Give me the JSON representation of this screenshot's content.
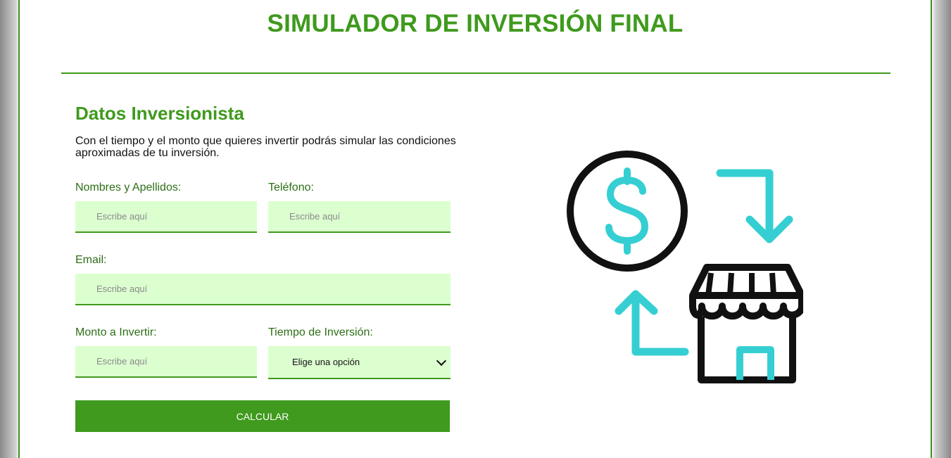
{
  "header": {
    "title": "SIMULADOR DE INVERSIÓN FINAL"
  },
  "form": {
    "section_title": "Datos Inversionista",
    "intro": "Con el tiempo y el monto que quieres invertir podrás simular las condiciones aproximadas de tu inversión.",
    "fields": {
      "name": {
        "label": "Nombres y Apellidos:",
        "placeholder": "Escribe aquí",
        "value": ""
      },
      "phone": {
        "label": "Teléfono:",
        "placeholder": "Escribe aquí",
        "value": ""
      },
      "email": {
        "label": "Email:",
        "placeholder": "Escribe aquí",
        "value": ""
      },
      "amount": {
        "label": "Monto a Invertir:",
        "placeholder": "Escribe aquí",
        "value": ""
      },
      "term": {
        "label": "Tiempo de Inversión:",
        "selected": "Elige una opción"
      }
    },
    "submit_label": "CALCULAR"
  },
  "illustration": {
    "icon": "investment-exchange-icon",
    "colors": {
      "primary": "#111111",
      "accent": "#35cfd3"
    }
  },
  "colors": {
    "brand": "#3f9a1d",
    "field_bg": "#dcffd0"
  }
}
